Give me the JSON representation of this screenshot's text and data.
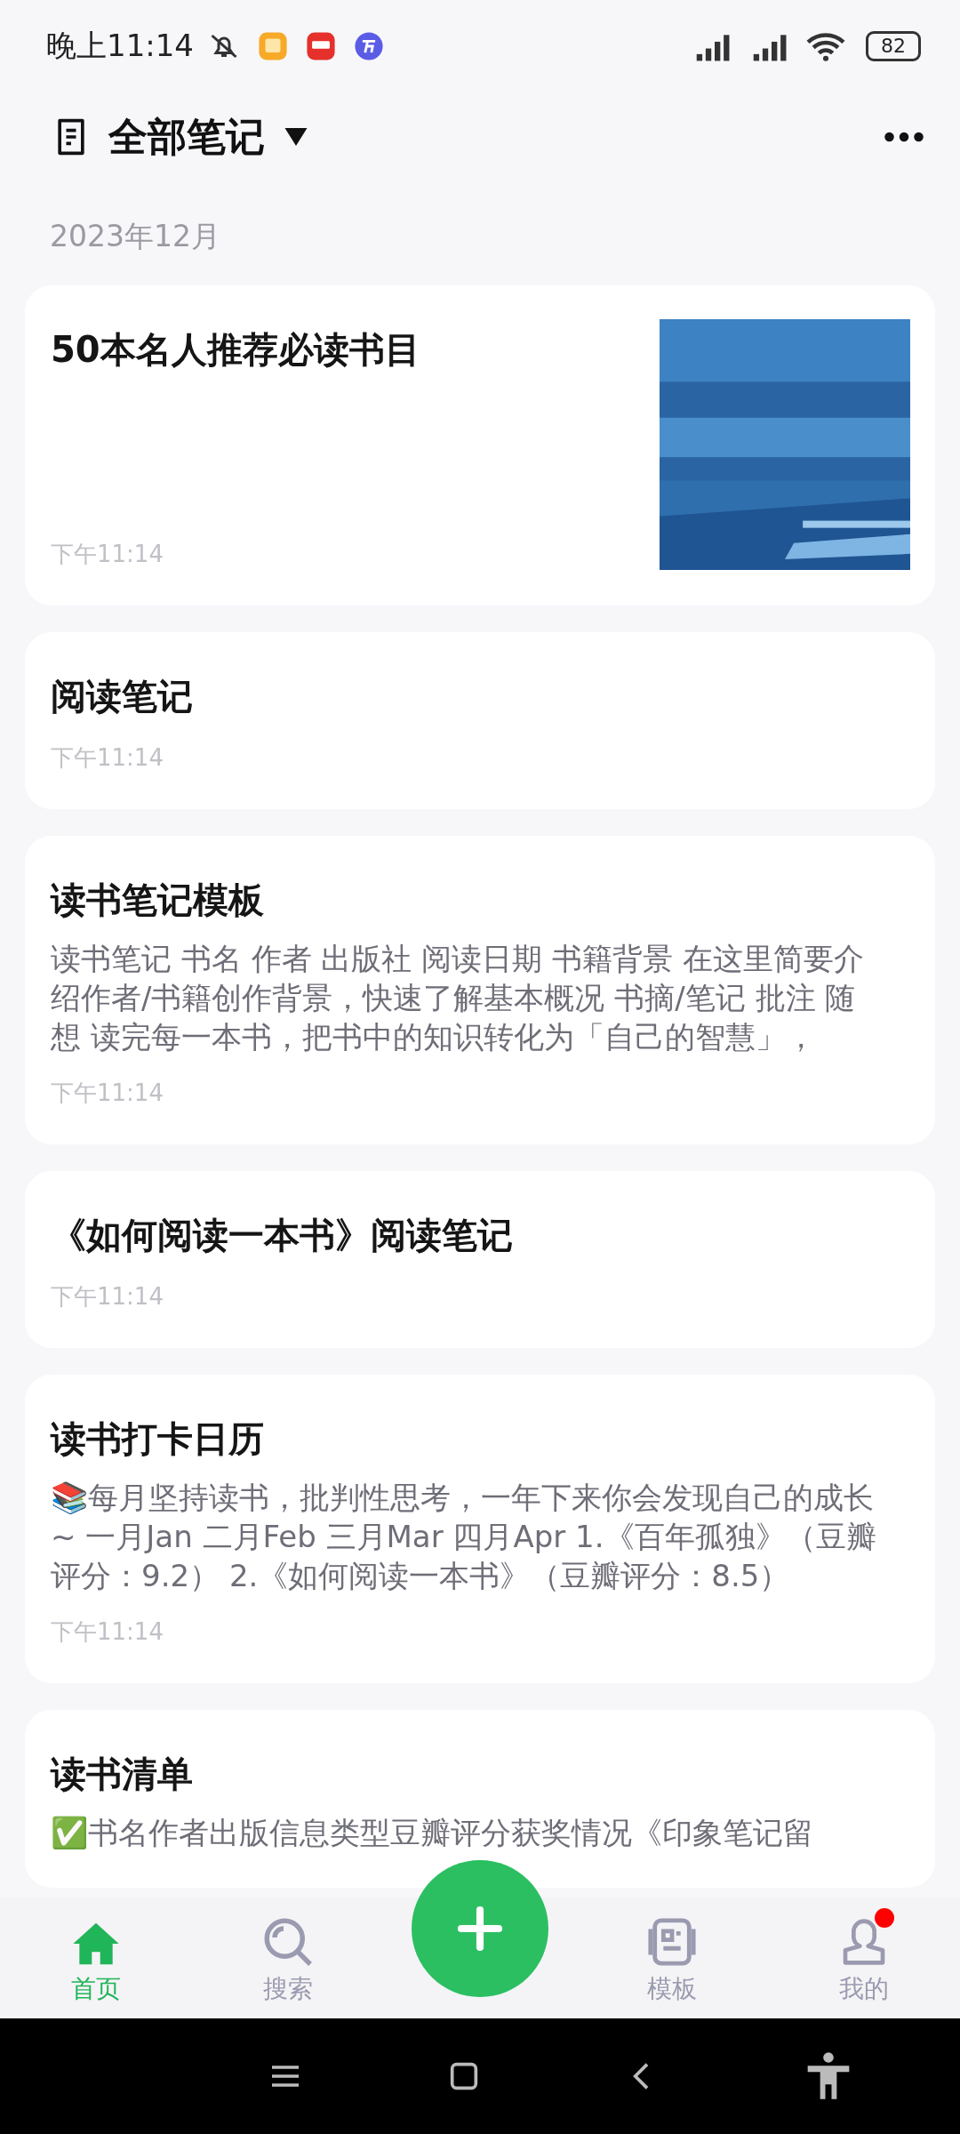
{
  "status_bar": {
    "time": "晚上11:14",
    "battery": "82"
  },
  "header": {
    "title": "全部笔记"
  },
  "section": {
    "date": "2023年12月"
  },
  "notes": [
    {
      "title": "50本名人推荐必读书目",
      "time": "下午11:14"
    },
    {
      "kind": "text",
      "title": "阅读笔记",
      "time": "下午11:14"
    },
    {
      "kind": "text",
      "title": "读书笔记模板",
      "excerpt": "读书笔记 书名 作者 出版社 阅读日期 书籍背景 在这里简要介绍作者/书籍创作背景，快速了解基本概况 书摘/笔记 批注 随想 读完每一本书，把书中的知识转化为「自己的智慧」，",
      "time": "下午11:14"
    },
    {
      "kind": "text",
      "title": "《如何阅读一本书》阅读笔记",
      "time": "下午11:14"
    },
    {
      "kind": "text",
      "title": "读书打卡日历",
      "excerpt": "📚每月坚持读书，批判性思考，一年下来你会发现自己的成长 ~ 一月Jan 二月Feb 三月Mar 四月Apr 1.《百年孤独》（豆瓣评分：9.2） 2.《如何阅读一本书》（豆瓣评分：8.5）",
      "time": "下午11:14"
    },
    {
      "kind": "text",
      "title": "读书清单",
      "excerpt": "✅书名作者出版信息类型豆瓣评分获奖情况《印象笔记留"
    }
  ],
  "bottom_nav": [
    {
      "kind": "home",
      "label": "首页",
      "selected": true,
      "dot": false
    },
    {
      "kind": "search",
      "label": "搜索",
      "selected": false,
      "dot": false
    },
    {
      "kind": "add"
    },
    {
      "kind": "template",
      "label": "模板",
      "selected": false,
      "dot": false
    },
    {
      "kind": "profile",
      "label": "我的",
      "selected": false,
      "dot": true
    }
  ]
}
